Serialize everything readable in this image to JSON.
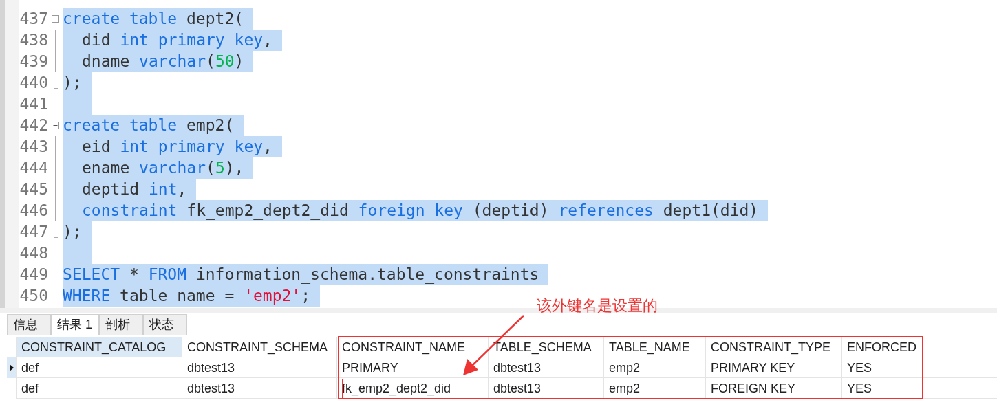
{
  "editor": {
    "lines": [
      {
        "number": "437",
        "foldable": true,
        "indent": false,
        "selected": true,
        "tokens": [
          {
            "kind": "kw",
            "text": "create table"
          },
          {
            "kind": "plain",
            "text": " dept2("
          }
        ]
      },
      {
        "number": "438",
        "foldable": false,
        "indent": true,
        "selected": true,
        "tokens": [
          {
            "kind": "plain",
            "text": "did "
          },
          {
            "kind": "kw",
            "text": "int primary key"
          },
          {
            "kind": "plain",
            "text": ","
          }
        ]
      },
      {
        "number": "439",
        "foldable": false,
        "indent": true,
        "selected": true,
        "tokens": [
          {
            "kind": "plain",
            "text": "dname "
          },
          {
            "kind": "kw",
            "text": "varchar"
          },
          {
            "kind": "plain",
            "text": "("
          },
          {
            "kind": "num",
            "text": "50"
          },
          {
            "kind": "plain",
            "text": ")"
          }
        ]
      },
      {
        "number": "440",
        "foldable": false,
        "indent": false,
        "selected": true,
        "tokens": [
          {
            "kind": "plain",
            "text": ");"
          }
        ]
      },
      {
        "number": "441",
        "foldable": false,
        "indent": true,
        "selected": true
      },
      {
        "number": "442",
        "foldable": true,
        "indent": false,
        "selected": true,
        "tokens": [
          {
            "kind": "kw",
            "text": "create table"
          },
          {
            "kind": "plain",
            "text": " emp2("
          }
        ]
      },
      {
        "number": "443",
        "foldable": false,
        "indent": true,
        "selected": true,
        "tokens": [
          {
            "kind": "plain",
            "text": "eid "
          },
          {
            "kind": "kw",
            "text": "int primary key"
          },
          {
            "kind": "plain",
            "text": ","
          }
        ]
      },
      {
        "number": "444",
        "foldable": false,
        "indent": true,
        "selected": true,
        "tokens": [
          {
            "kind": "plain",
            "text": "ename "
          },
          {
            "kind": "kw",
            "text": "varchar"
          },
          {
            "kind": "plain",
            "text": "("
          },
          {
            "kind": "num",
            "text": "5"
          },
          {
            "kind": "plain",
            "text": "),"
          }
        ]
      },
      {
        "number": "445",
        "foldable": false,
        "indent": true,
        "selected": true,
        "tokens": [
          {
            "kind": "plain",
            "text": "deptid "
          },
          {
            "kind": "kw",
            "text": "int"
          },
          {
            "kind": "plain",
            "text": ","
          }
        ]
      },
      {
        "number": "446",
        "foldable": false,
        "indent": true,
        "selected": true,
        "tokens": [
          {
            "kind": "kw",
            "text": "constraint"
          },
          {
            "kind": "plain",
            "text": " fk_emp2_dept2_did "
          },
          {
            "kind": "kw",
            "text": "foreign key"
          },
          {
            "kind": "plain",
            "text": " (deptid) "
          },
          {
            "kind": "kw",
            "text": "references"
          },
          {
            "kind": "plain",
            "text": " dept1(did)"
          }
        ]
      },
      {
        "number": "447",
        "foldable": false,
        "indent": false,
        "selected": true,
        "tokens": [
          {
            "kind": "plain",
            "text": ");"
          }
        ]
      },
      {
        "number": "448",
        "foldable": false,
        "indent": true,
        "selected": true
      },
      {
        "number": "449",
        "foldable": false,
        "indent": false,
        "selected": true,
        "tokens": [
          {
            "kind": "kw",
            "text": "SELECT"
          },
          {
            "kind": "plain",
            "text": " * "
          },
          {
            "kind": "kw",
            "text": "FROM"
          },
          {
            "kind": "plain",
            "text": " information_schema.table_constraints"
          }
        ]
      },
      {
        "number": "450",
        "foldable": false,
        "indent": false,
        "selected": true,
        "tokens": [
          {
            "kind": "kw",
            "text": "WHERE"
          },
          {
            "kind": "plain",
            "text": " table_name = "
          },
          {
            "kind": "str",
            "text": "'emp2'"
          },
          {
            "kind": "plain",
            "text": ";"
          }
        ]
      }
    ]
  },
  "tabs": [
    {
      "label": "信息",
      "selected": false
    },
    {
      "label": "结果 1",
      "selected": true
    },
    {
      "label": "剖析",
      "selected": false
    },
    {
      "label": "状态",
      "selected": false
    }
  ],
  "table": {
    "columns": [
      {
        "label": "CONSTRAINT_CATALOG",
        "selected": true
      },
      {
        "label": "CONSTRAINT_SCHEMA",
        "selected": false
      },
      {
        "label": "CONSTRAINT_NAME",
        "selected": false
      },
      {
        "label": "TABLE_SCHEMA",
        "selected": false
      },
      {
        "label": "TABLE_NAME",
        "selected": false
      },
      {
        "label": "CONSTRAINT_TYPE",
        "selected": false
      },
      {
        "label": "ENFORCED",
        "selected": false
      }
    ],
    "rows": [
      {
        "selected": true,
        "cells": [
          "def",
          "dbtest13",
          "PRIMARY",
          "dbtest13",
          "emp2",
          "PRIMARY KEY",
          "YES"
        ]
      },
      {
        "selected": false,
        "cells": [
          "def",
          "dbtest13",
          "fk_emp2_dept2_did",
          "dbtest13",
          "emp2",
          "FOREIGN KEY",
          "YES"
        ]
      }
    ]
  },
  "annotation": {
    "text": "该外键名是设置的"
  }
}
